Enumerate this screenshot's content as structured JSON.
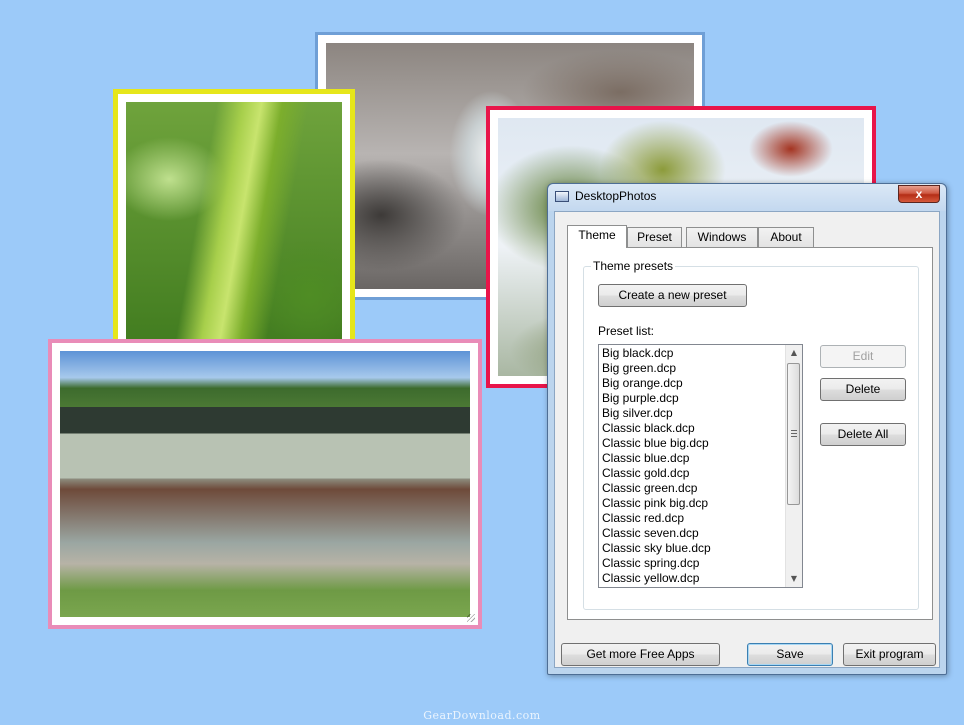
{
  "window": {
    "title": "DesktopPhotos",
    "close_symbol": "x"
  },
  "tabs": [
    {
      "label": "Theme",
      "active": true
    },
    {
      "label": "Preset",
      "active": false
    },
    {
      "label": "Windows",
      "active": false
    },
    {
      "label": "About",
      "active": false
    }
  ],
  "theme_panel": {
    "group_title": "Theme presets",
    "create_button": "Create a new preset",
    "preset_list_label": "Preset list:",
    "presets": [
      "Big black.dcp",
      "Big green.dcp",
      "Big orange.dcp",
      "Big purple.dcp",
      "Big silver.dcp",
      "Classic black.dcp",
      "Classic blue big.dcp",
      "Classic blue.dcp",
      "Classic gold.dcp",
      "Classic green.dcp",
      "Classic pink big.dcp",
      "Classic red.dcp",
      "Classic seven.dcp",
      "Classic sky blue.dcp",
      "Classic spring.dcp",
      "Classic yellow.dcp"
    ],
    "edit_button": "Edit",
    "delete_button": "Delete",
    "delete_all_button": "Delete All"
  },
  "footer": {
    "more_apps_button": "Get more Free Apps",
    "save_button": "Save",
    "exit_button": "Exit program"
  },
  "watermark": "GearDownload.com",
  "colors": {
    "desktop": "#9ccaf9",
    "frame_yellow": "#e6e61a",
    "frame_red": "#e8154a",
    "frame_pink": "#e98cb8",
    "frame_blue": "#6f9fd6"
  }
}
